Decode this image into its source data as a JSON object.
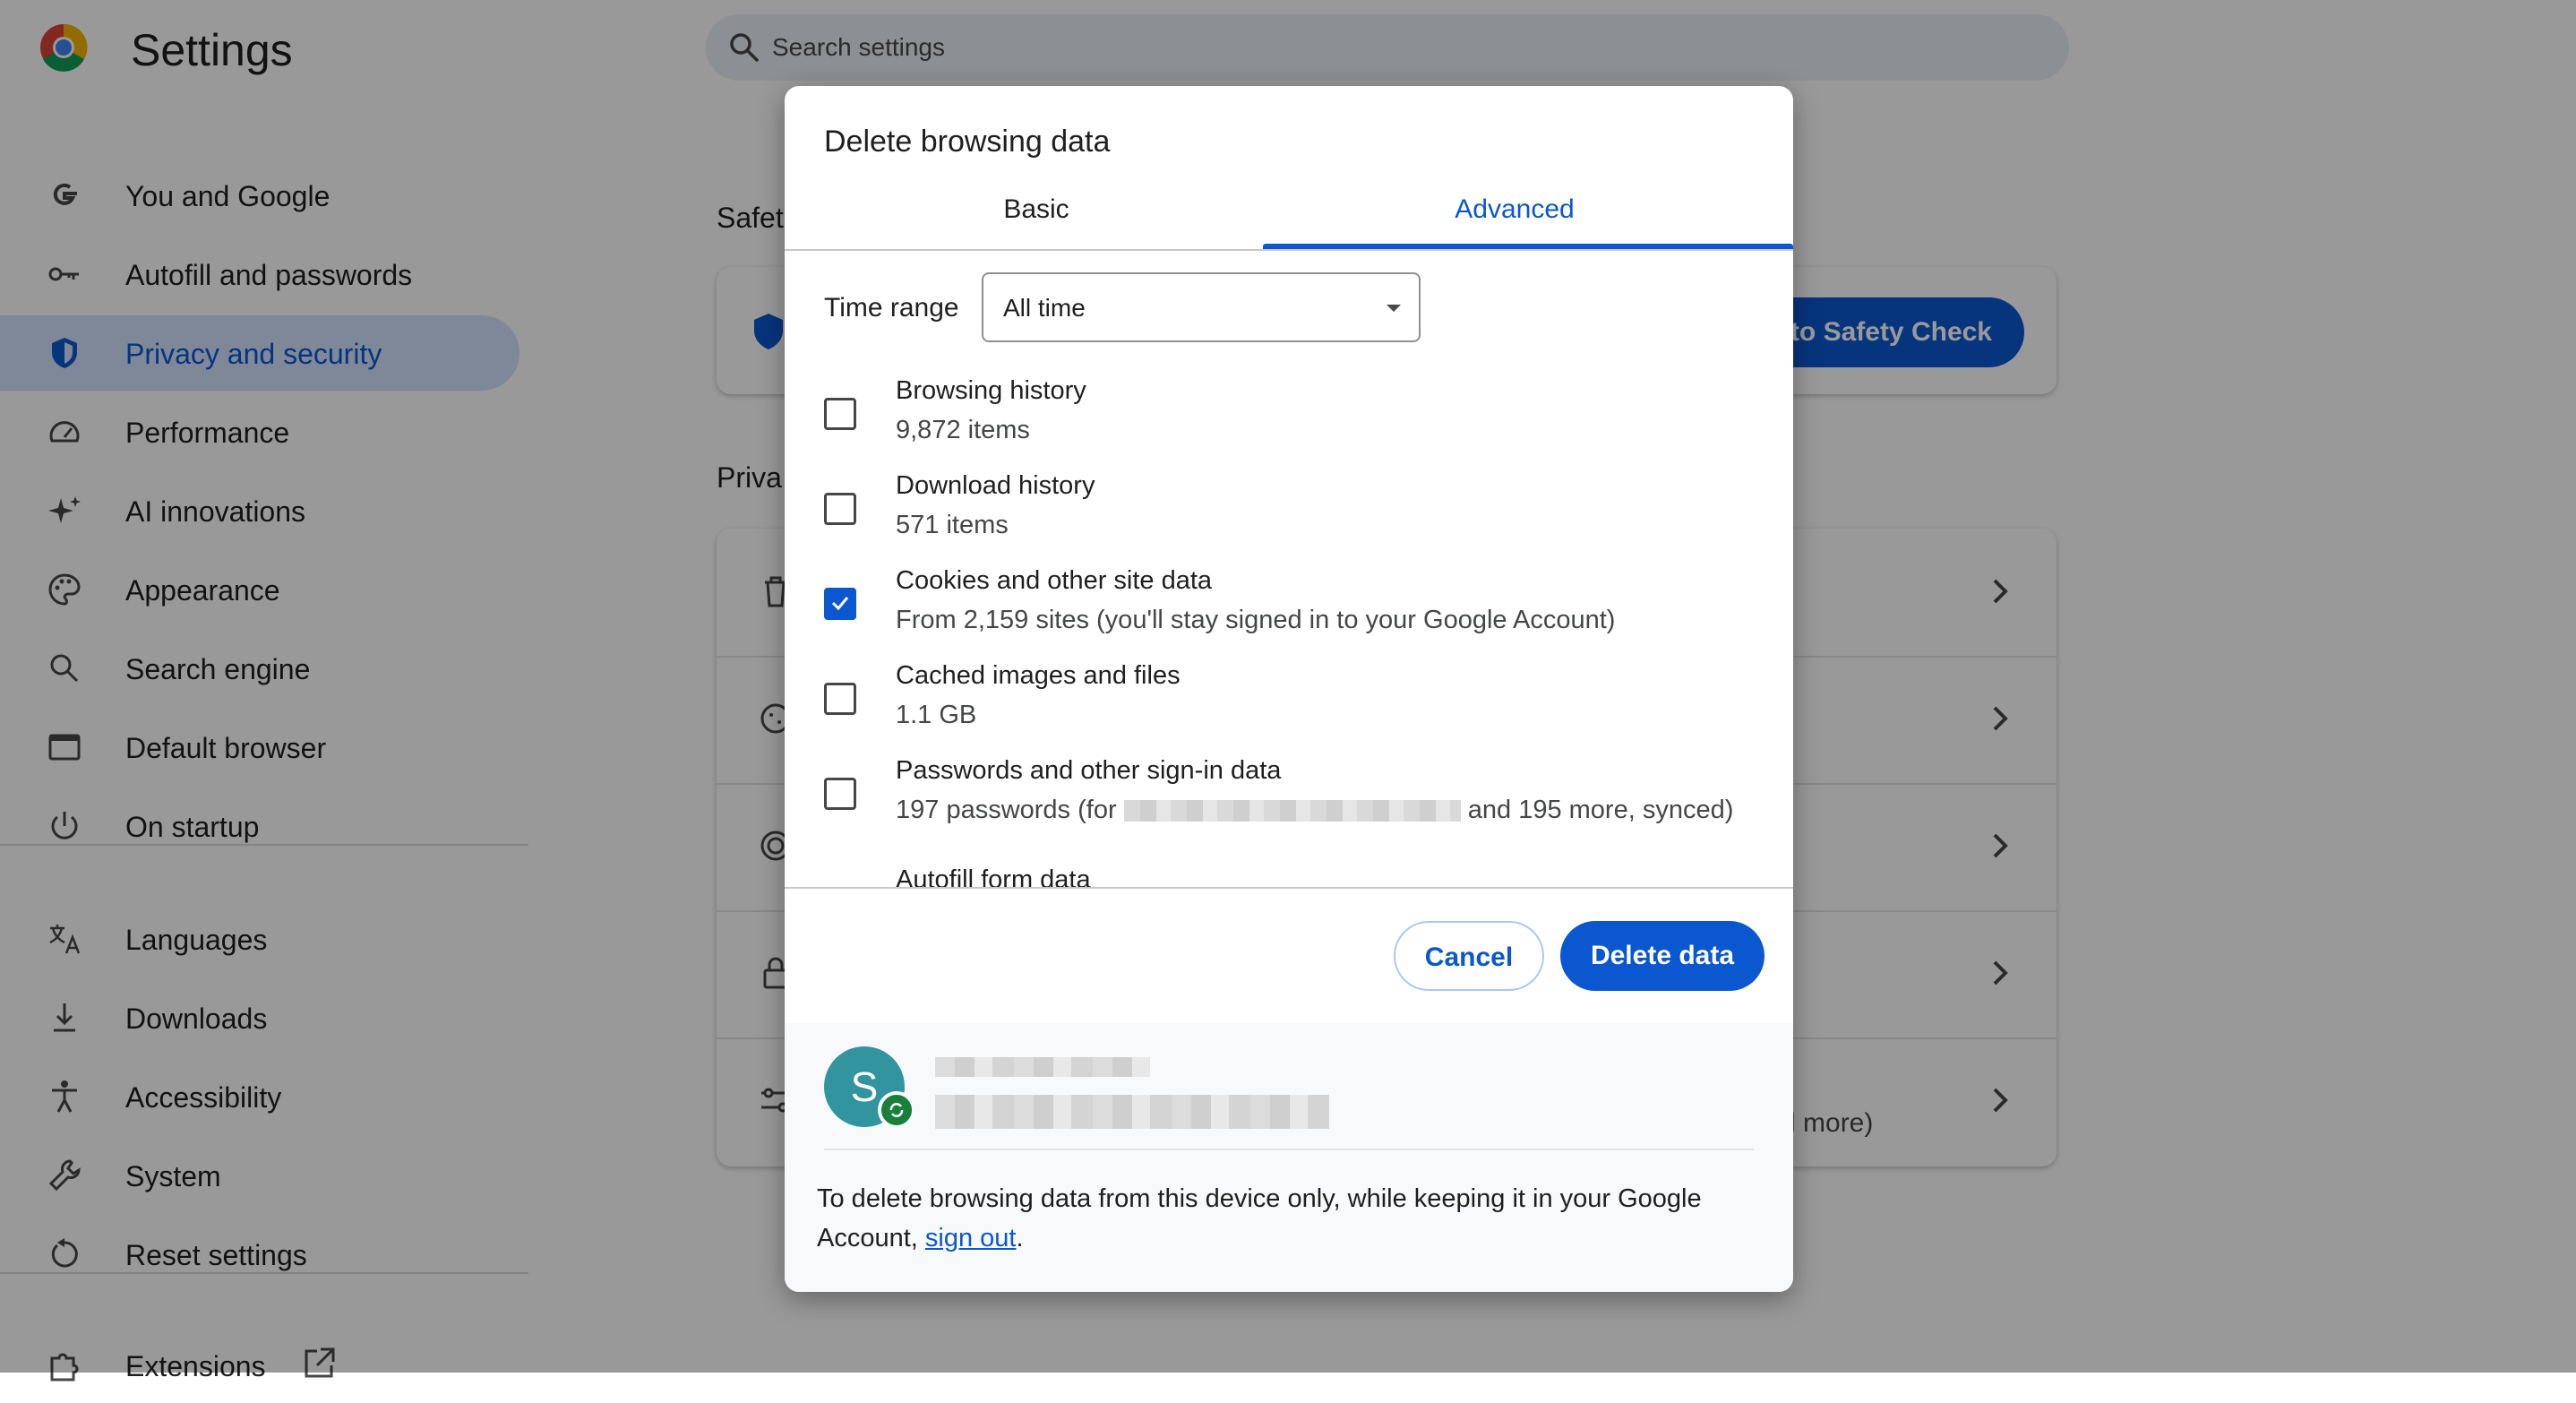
{
  "app": {
    "title": "Settings"
  },
  "search": {
    "placeholder": "Search settings"
  },
  "sidebar": {
    "items": [
      {
        "label": "You and Google",
        "icon": "google-g-icon"
      },
      {
        "label": "Autofill and passwords",
        "icon": "key-icon"
      },
      {
        "label": "Privacy and security",
        "icon": "shield-icon",
        "active": true
      },
      {
        "label": "Performance",
        "icon": "speedometer-icon"
      },
      {
        "label": "AI innovations",
        "icon": "sparkle-icon"
      },
      {
        "label": "Appearance",
        "icon": "palette-icon"
      },
      {
        "label": "Search engine",
        "icon": "search-icon"
      },
      {
        "label": "Default browser",
        "icon": "browser-window-icon"
      },
      {
        "label": "On startup",
        "icon": "power-icon"
      },
      {
        "label": "Languages",
        "icon": "translate-icon"
      },
      {
        "label": "Downloads",
        "icon": "download-icon"
      },
      {
        "label": "Accessibility",
        "icon": "accessibility-icon"
      },
      {
        "label": "System",
        "icon": "wrench-icon"
      },
      {
        "label": "Reset settings",
        "icon": "reset-icon"
      },
      {
        "label": "Extensions",
        "icon": "puzzle-icon"
      }
    ]
  },
  "background": {
    "safety_section": "Safet",
    "safety_button": "to Safety Check",
    "privacy_section": "Priva",
    "row_fragment": "d more)"
  },
  "dialog": {
    "title": "Delete browsing data",
    "tabs": {
      "basic": "Basic",
      "advanced": "Advanced",
      "active": "advanced"
    },
    "time_range_label": "Time range",
    "time_range_value": "All time",
    "options": [
      {
        "title": "Browsing history",
        "subtitle": "9,872 items",
        "checked": false
      },
      {
        "title": "Download history",
        "subtitle": "571 items",
        "checked": false
      },
      {
        "title": "Cookies and other site data",
        "subtitle": "From 2,159 sites (you'll stay signed in to your Google Account)",
        "checked": true
      },
      {
        "title": "Cached images and files",
        "subtitle": "1.1 GB",
        "checked": false
      },
      {
        "title": "Passwords and other sign-in data",
        "subtitle_prefix": "197 passwords (for",
        "subtitle_suffix": "and 195 more, synced)",
        "checked": false
      },
      {
        "title": "Autofill form data",
        "checked": false
      }
    ],
    "cancel_label": "Cancel",
    "delete_label": "Delete data",
    "account": {
      "avatar_letter": "S"
    },
    "footer_text": "To delete browsing data from this device only, while keeping it in your Google Account,",
    "footer_link": "sign out",
    "footer_end": "."
  },
  "colors": {
    "accent": "#0b57d0",
    "active_nav_bg": "#d3e3fd",
    "avatar_bg": "#31949e",
    "sync_badge": "#188038"
  }
}
